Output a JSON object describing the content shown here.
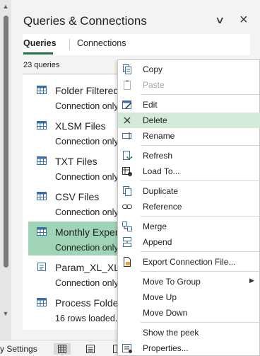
{
  "pane": {
    "title": "Queries & Connections",
    "tabs": [
      "Queries",
      "Connections"
    ],
    "count": "23 queries"
  },
  "queries": [
    {
      "name": "Folder Filtered",
      "sub": "Connection only.",
      "icon": "table-icon"
    },
    {
      "name": "XLSM Files",
      "sub": "Connection only.",
      "icon": "table-icon"
    },
    {
      "name": "TXT Files",
      "sub": "Connection only.",
      "icon": "table-icon"
    },
    {
      "name": "CSV Files",
      "sub": "Connection only.",
      "icon": "table-icon"
    },
    {
      "name": "Monthly Expenses",
      "sub": "Connection only.",
      "icon": "table-icon"
    },
    {
      "name": "Param_XL_XLSX",
      "sub": "Connection only.",
      "icon": "parameter-icon"
    },
    {
      "name": "Process Folder",
      "sub": "16 rows loaded.",
      "icon": "table-icon"
    }
  ],
  "status": {
    "text": "y Settings"
  },
  "menu": {
    "items": [
      {
        "label": "Copy",
        "icon": "copy-icon"
      },
      {
        "label": "Paste",
        "icon": "paste-icon",
        "disabled": true
      },
      {
        "label": "Edit",
        "icon": "edit-icon"
      },
      {
        "label": "Delete",
        "icon": "delete-icon"
      },
      {
        "label": "Rename",
        "icon": "rename-icon"
      },
      {
        "label": "Refresh",
        "icon": "refresh-icon"
      },
      {
        "label": "Load To...",
        "icon": "load-to-icon"
      },
      {
        "label": "Duplicate",
        "icon": "duplicate-icon"
      },
      {
        "label": "Reference",
        "icon": "reference-icon"
      },
      {
        "label": "Merge",
        "icon": "merge-icon"
      },
      {
        "label": "Append",
        "icon": "append-icon"
      },
      {
        "label": "Export Connection File...",
        "icon": "export-icon"
      },
      {
        "label": "Move To Group",
        "icon": "",
        "submenu": true
      },
      {
        "label": "Move Up",
        "icon": ""
      },
      {
        "label": "Move Down",
        "icon": ""
      },
      {
        "label": "Show the peek",
        "icon": ""
      },
      {
        "label": "Properties...",
        "icon": "properties-icon"
      }
    ]
  },
  "colors": {
    "selected_row": "#9fd5b6",
    "menu_hover": "#d4ead9",
    "accent": "#217346"
  }
}
